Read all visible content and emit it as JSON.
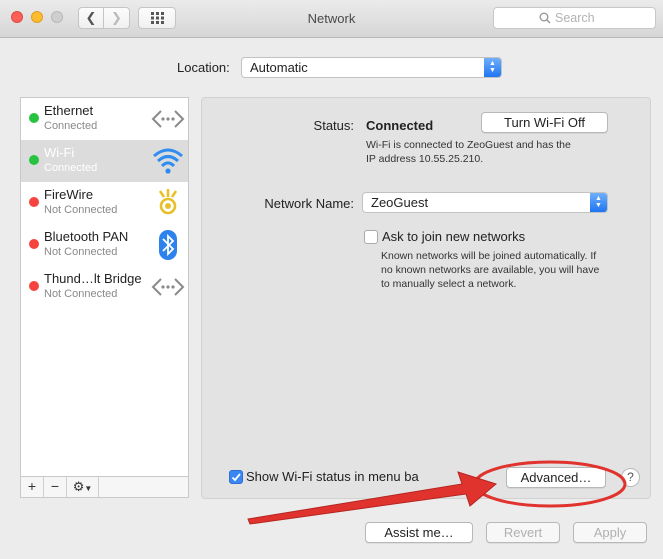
{
  "window": {
    "title": "Network"
  },
  "toolbar": {
    "search_placeholder": "Search"
  },
  "location": {
    "label": "Location:",
    "value": "Automatic"
  },
  "services": [
    {
      "name": "Ethernet",
      "status": "Connected",
      "status_color": "#27c240",
      "icon": "ethernet-icon"
    },
    {
      "name": "Wi-Fi",
      "status": "Connected",
      "status_color": "#27c240",
      "icon": "wifi-icon",
      "selected": true
    },
    {
      "name": "FireWire",
      "status": "Not Connected",
      "status_color": "#f5433d",
      "icon": "firewire-icon"
    },
    {
      "name": "Bluetooth PAN",
      "status": "Not Connected",
      "status_color": "#f5433d",
      "icon": "bluetooth-icon"
    },
    {
      "name": "Thund…lt Bridge",
      "status": "Not Connected",
      "status_color": "#f5433d",
      "icon": "thunderbolt-bridge-icon"
    }
  ],
  "sidebar_controls": {
    "add": "+",
    "remove": "−"
  },
  "detail": {
    "status_label": "Status:",
    "status_value": "Connected",
    "turn_off_button": "Turn Wi-Fi Off",
    "status_desc_line1": "Wi-Fi is connected to ZeoGuest and has the",
    "status_desc_line2": "IP address 10.55.25.210.",
    "network_name_label": "Network Name:",
    "network_name_value": "ZeoGuest",
    "ask_join_label": "Ask to join new networks",
    "ask_join_checked": false,
    "ask_desc_line1": "Known networks will be joined automatically. If",
    "ask_desc_line2": "no known networks are available, you will have",
    "ask_desc_line3": "to manually select a network.",
    "show_status_label": "Show Wi-Fi status in menu ba",
    "show_status_checked": true,
    "advanced_button": "Advanced…",
    "help_button": "?"
  },
  "footer": {
    "assist_button": "Assist me…",
    "revert_button": "Revert",
    "apply_button": "Apply"
  },
  "colors": {
    "accent": "#3a86f5",
    "annotation": "#e0332e",
    "wifi_blue": "#2f8cf0"
  }
}
